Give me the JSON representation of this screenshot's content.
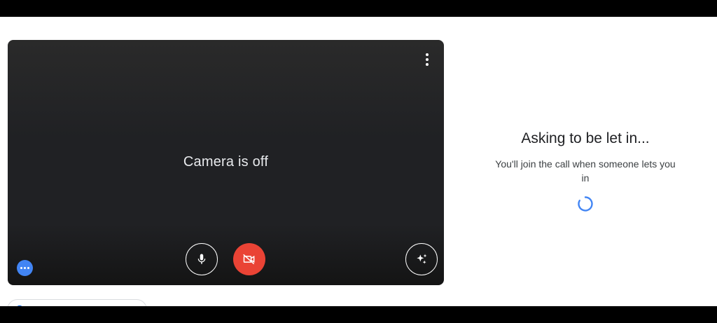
{
  "preview": {
    "camera_status": "Camera is off"
  },
  "controls": {
    "mic_icon": "mic-icon",
    "camera_icon": "videocam-off-icon",
    "effects_icon": "sparkle-effects-icon",
    "more_icon": "more-vert-icon",
    "camera_button_color": "#ea4335"
  },
  "waiting": {
    "title": "Asking to be let in...",
    "message": "You'll join the call when someone lets you in"
  },
  "spinner_color": "#4285f4"
}
